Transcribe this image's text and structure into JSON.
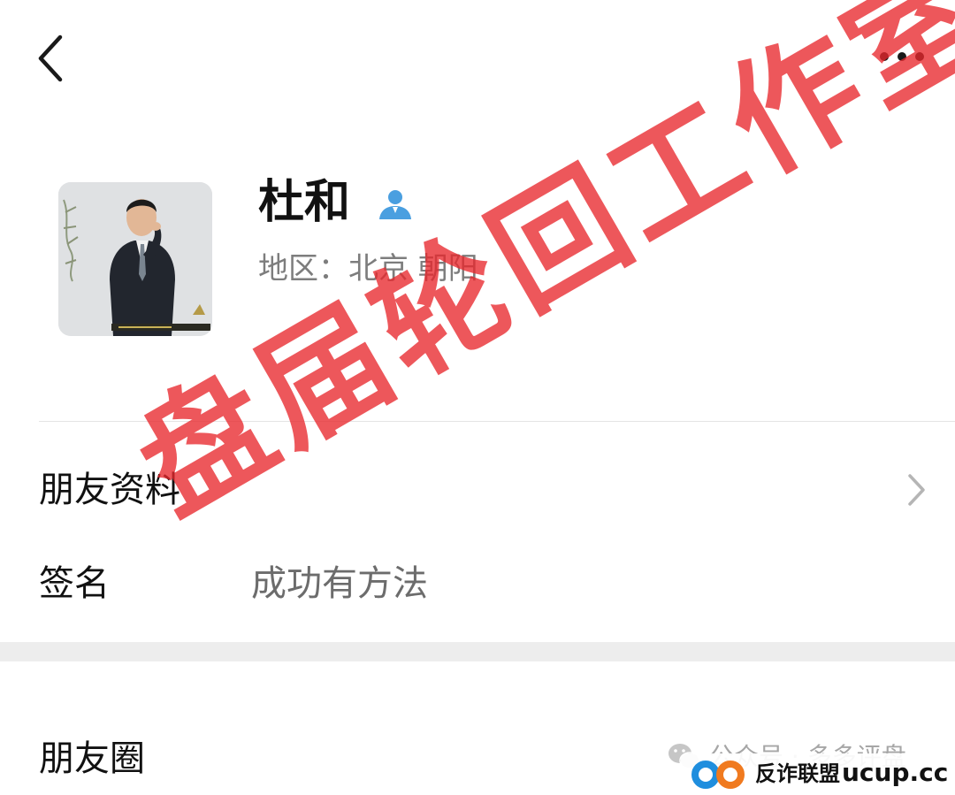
{
  "header": {
    "back_icon": "chevron-left-icon",
    "more_icon": "more-horizontal-icon"
  },
  "profile": {
    "name": "杜和",
    "region": "地区：北京 朝阳",
    "contact_icon": "contact-person-icon",
    "contact_icon_color": "#4a9fe0"
  },
  "rows": {
    "friend_info_label": "朋友资料",
    "signature_label": "签名",
    "signature_value": "成功有方法",
    "moments_label": "朋友圈"
  },
  "watermark": {
    "stamp_text": "盘届轮回工作室",
    "stamp_color": "#e8282d",
    "wechat_credit": "公众号 · 多多评盘",
    "brand_name": "反诈联盟",
    "brand_site": "ucup.cc"
  }
}
